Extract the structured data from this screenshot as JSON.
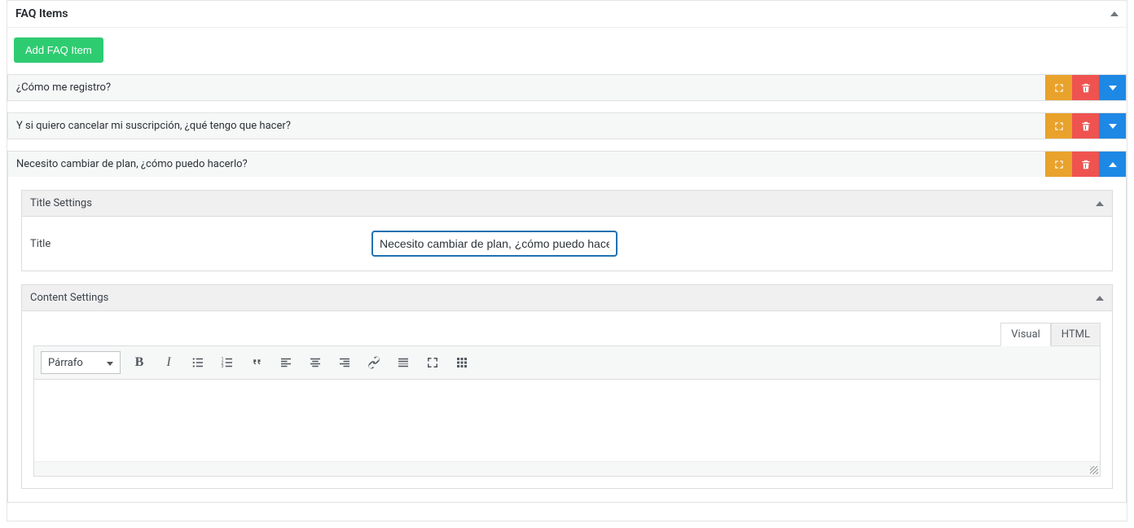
{
  "header": {
    "title": "FAQ Items"
  },
  "buttons": {
    "add": "Add FAQ Item"
  },
  "faq": {
    "items": [
      {
        "title": "¿Cómo me registro?"
      },
      {
        "title": "Y si quiero cancelar mi suscripción, ¿qué tengo que hacer?"
      },
      {
        "title": "Necesito cambiar de plan, ¿cómo puedo hacerlo?"
      }
    ]
  },
  "settings": {
    "title_group": "Title Settings",
    "title_label": "Title",
    "title_value": "Necesito cambiar de plan, ¿cómo puedo hacerl",
    "content_group": "Content Settings"
  },
  "editor": {
    "tabs": {
      "visual": "Visual",
      "html": "HTML"
    },
    "format": "Párrafo",
    "content": ""
  }
}
